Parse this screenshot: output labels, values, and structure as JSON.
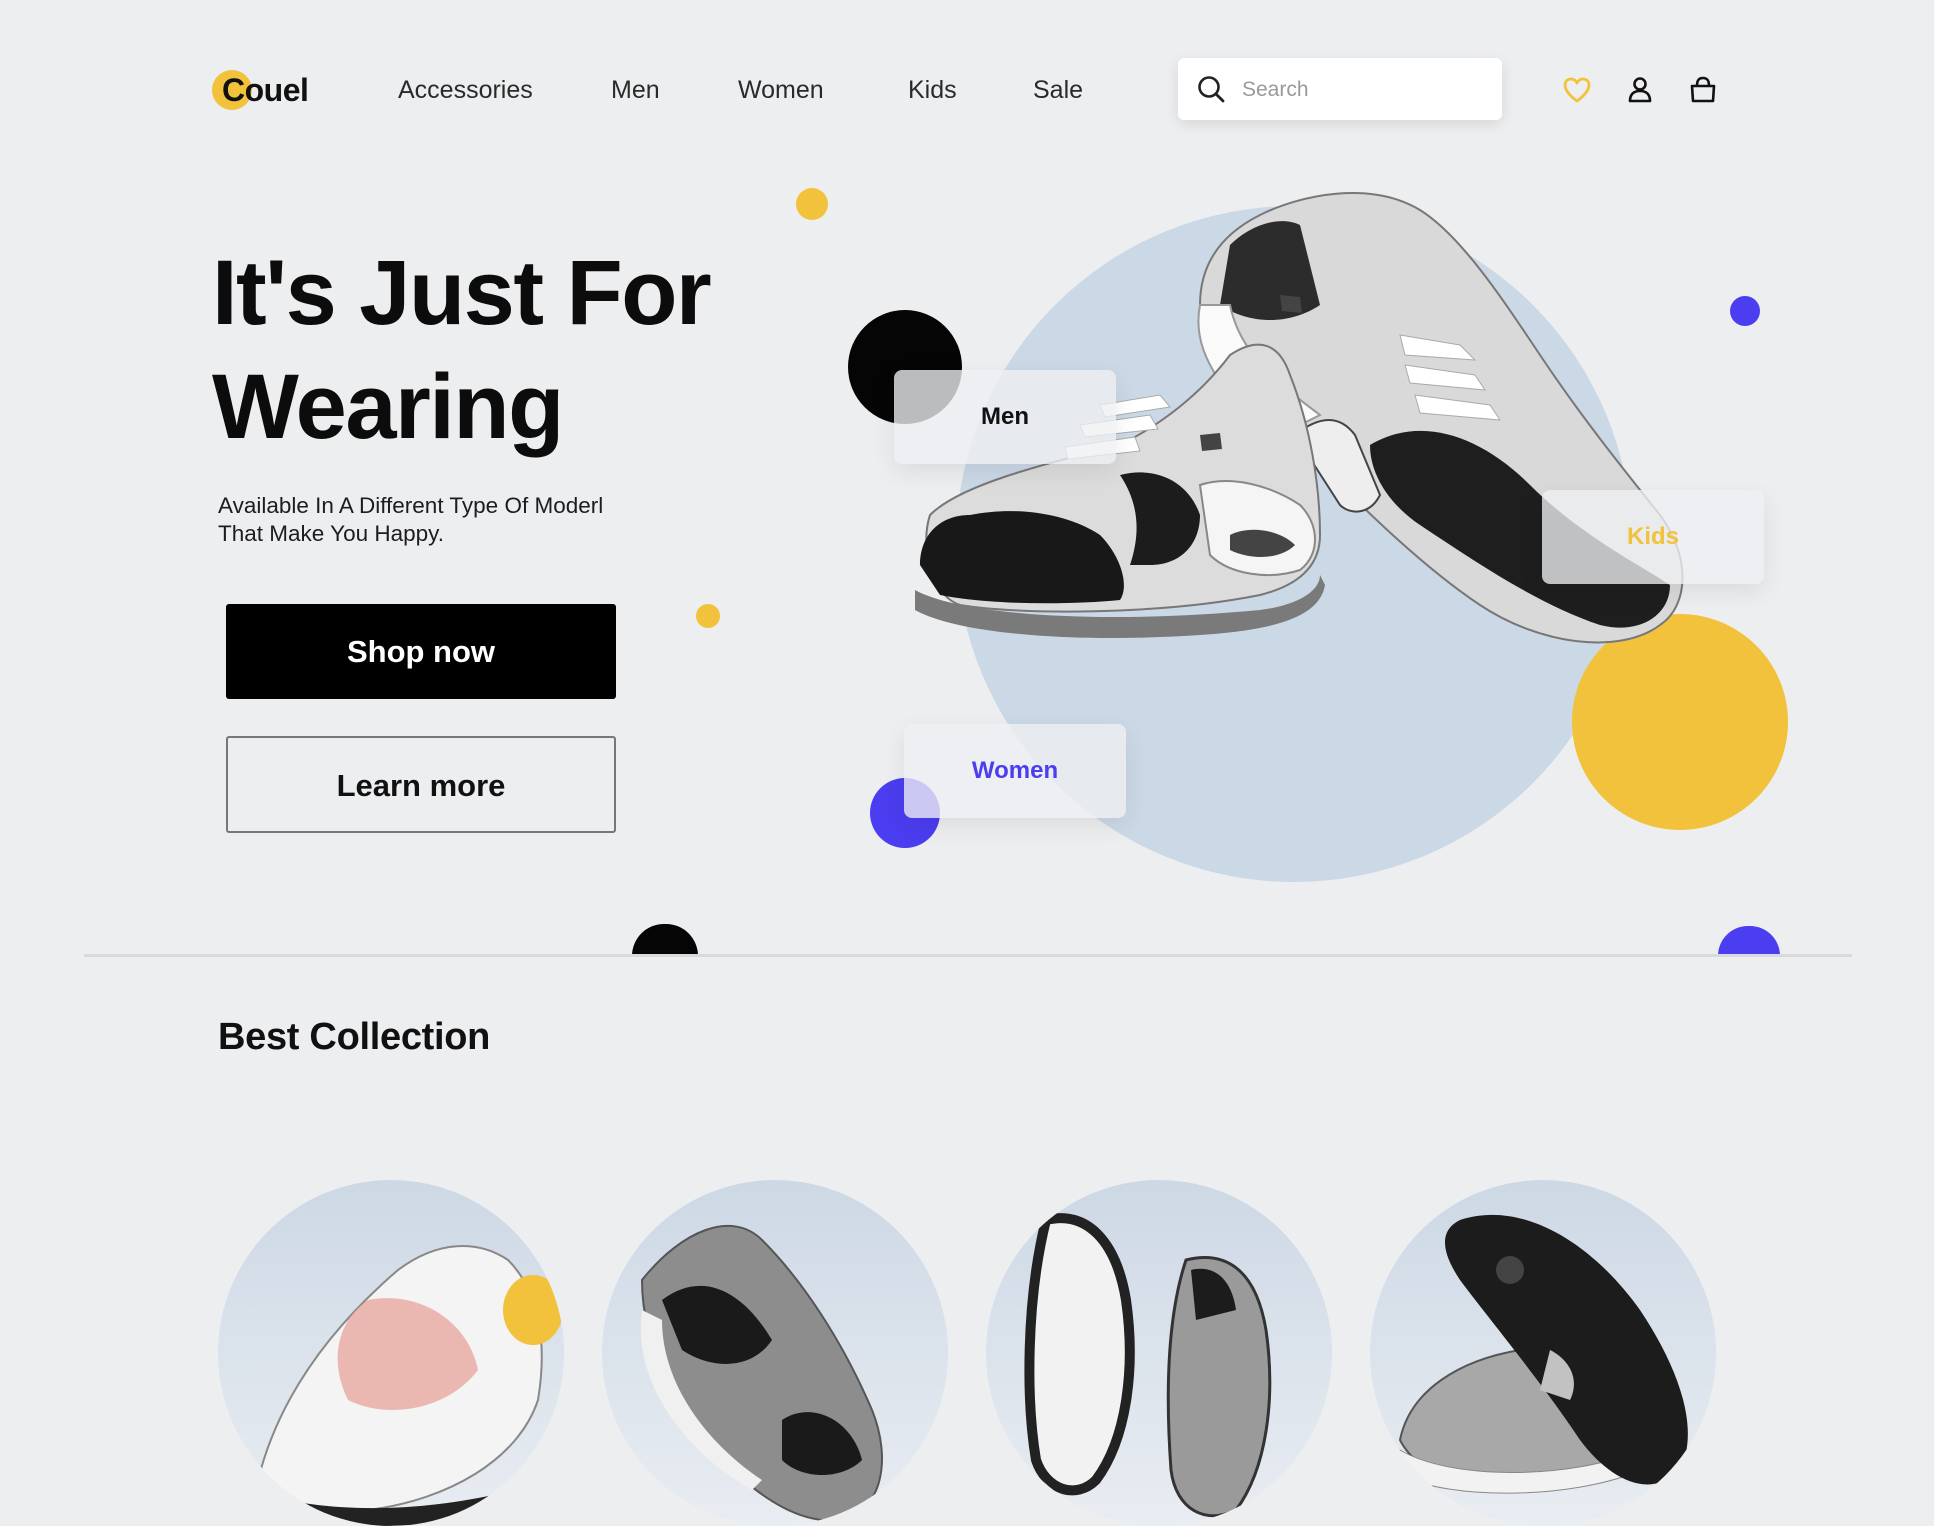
{
  "brand": {
    "name": "Couel",
    "accent": "#f2c23c",
    "purple": "#4b3df0"
  },
  "nav": {
    "items": [
      "Accessories",
      "Men",
      "Women",
      "Kids",
      "Sale"
    ]
  },
  "search": {
    "placeholder": "Search"
  },
  "header_icons": [
    "heart-icon",
    "user-icon",
    "shopping-bag-icon"
  ],
  "hero": {
    "title_line1": "It's Just For",
    "title_line2": "Wearing",
    "subtitle_line1": "Available In A Different Type Of Moderl",
    "subtitle_line2": "That Make You Happy.",
    "primary_button": "Shop now",
    "secondary_button": "Learn more",
    "chips": [
      {
        "label": "Men",
        "color": "#111111"
      },
      {
        "label": "Kids",
        "color": "#f2c23c"
      },
      {
        "label": "Women",
        "color": "#4b3df0"
      }
    ]
  },
  "collection": {
    "title": "Best Collection"
  }
}
